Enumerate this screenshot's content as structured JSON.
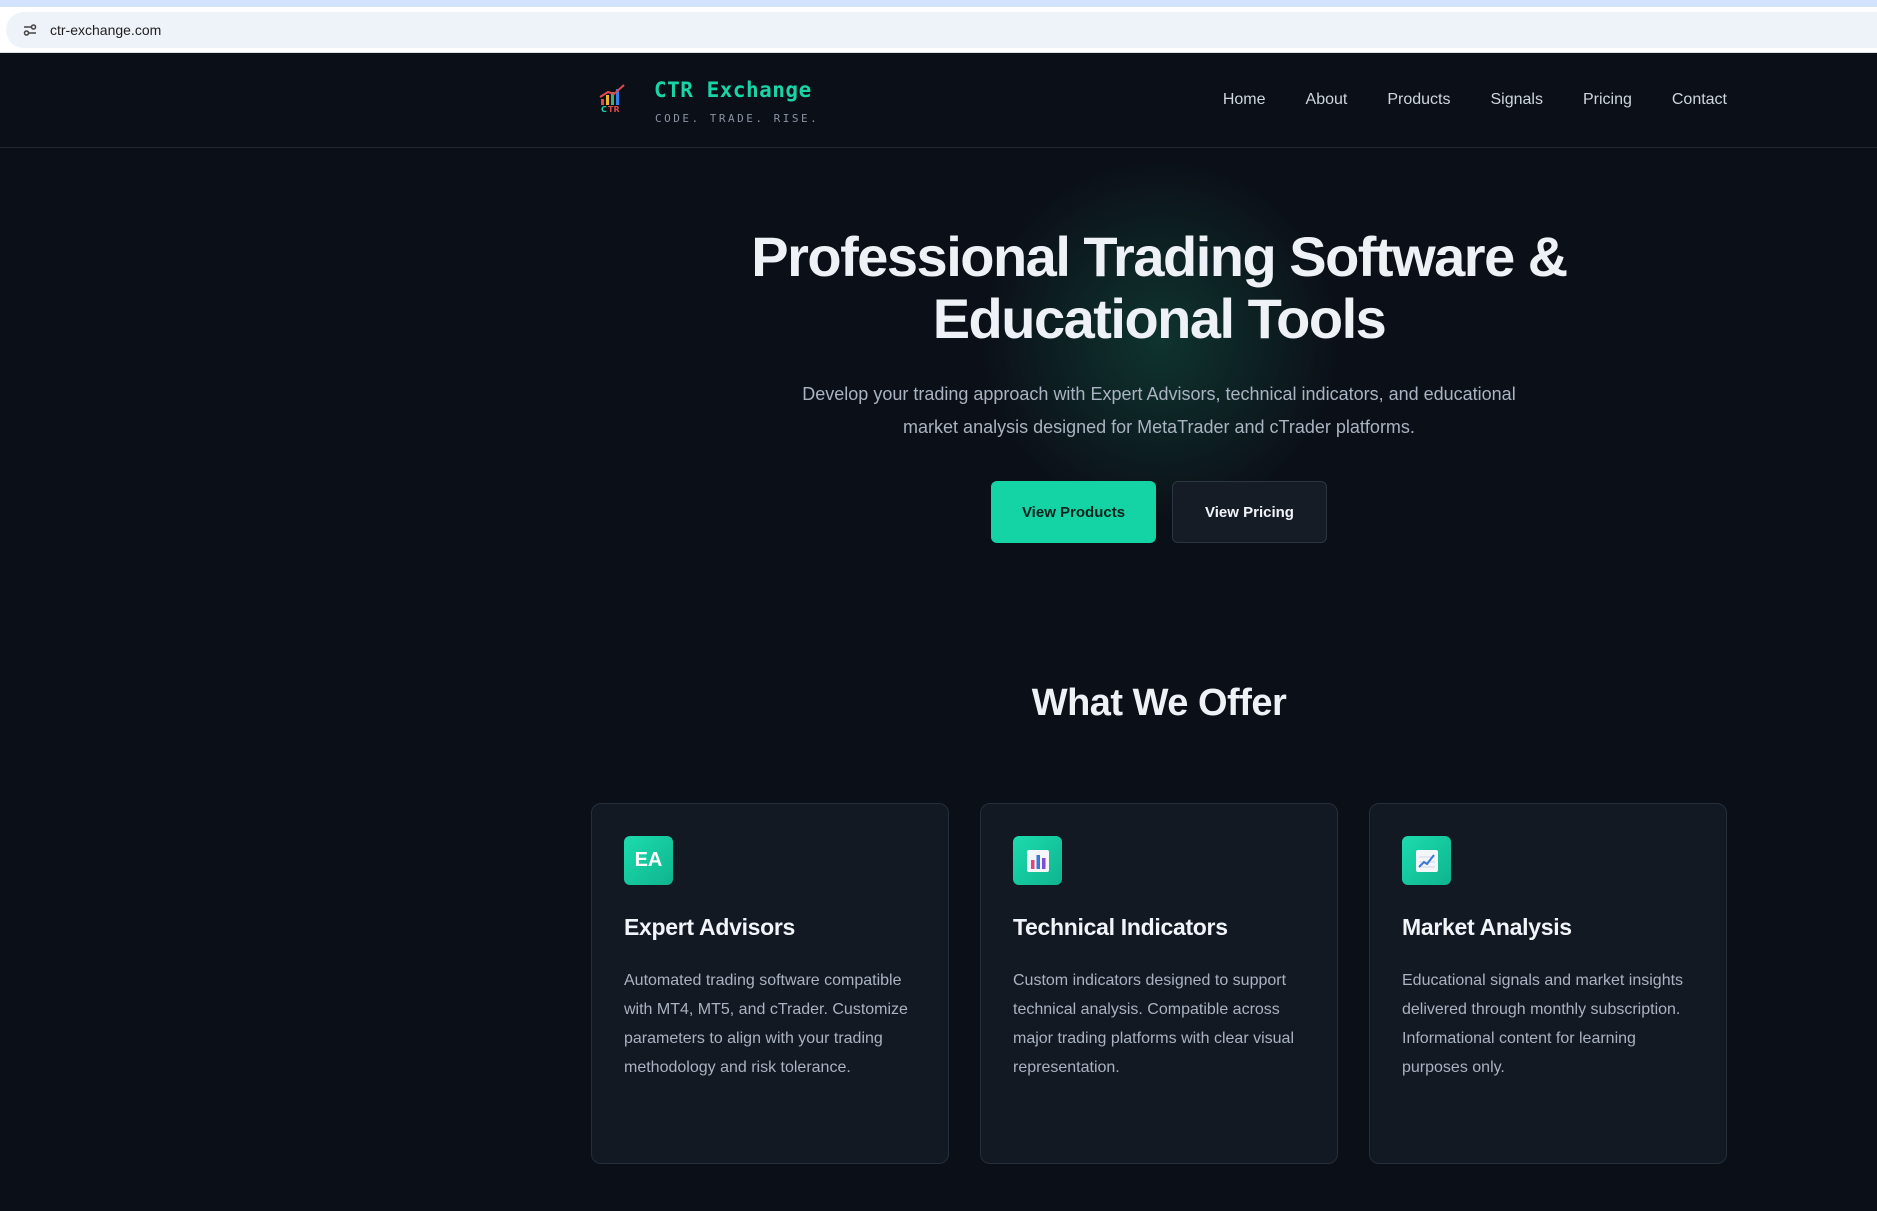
{
  "browser": {
    "url": "ctr-exchange.com"
  },
  "header": {
    "brand_name": "CTR Exchange",
    "tagline": "CODE. TRADE. RISE.",
    "nav": [
      {
        "label": "Home"
      },
      {
        "label": "About"
      },
      {
        "label": "Products"
      },
      {
        "label": "Signals"
      },
      {
        "label": "Pricing"
      },
      {
        "label": "Contact"
      }
    ]
  },
  "hero": {
    "title_line1": "Professional Trading Software &",
    "title_line2": "Educational Tools",
    "subtitle_line1": "Develop your trading approach with Expert Advisors, technical indicators, and educational",
    "subtitle_line2": "market analysis designed for MetaTrader and cTrader platforms.",
    "primary_button": "View Products",
    "secondary_button": "View Pricing"
  },
  "offer": {
    "title": "What We Offer",
    "cards": [
      {
        "icon": "ea-badge-icon",
        "icon_text": "EA",
        "title": "Expert Advisors",
        "text": "Automated trading software compatible with MT4, MT5, and cTrader. Customize parameters to align with your trading methodology and risk tolerance."
      },
      {
        "icon": "bar-chart-icon",
        "title": "Technical Indicators",
        "text": "Custom indicators designed to support technical analysis. Compatible across major trading platforms with clear visual representation."
      },
      {
        "icon": "line-chart-icon",
        "title": "Market Analysis",
        "text": "Educational signals and market insights delivered through monthly subscription. Informational content for learning purposes only."
      }
    ]
  },
  "colors": {
    "background": "#0b0f17",
    "accent": "#14d3a5",
    "card": "#131923"
  }
}
